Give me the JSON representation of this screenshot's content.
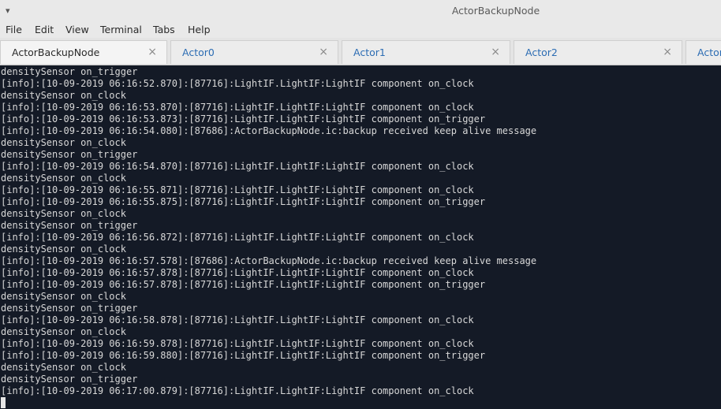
{
  "window": {
    "title": "ActorBackupNode",
    "menu_arrow": "▾"
  },
  "menubar": {
    "items": [
      "File",
      "Edit",
      "View",
      "Terminal",
      "Tabs",
      "Help"
    ]
  },
  "tabs": [
    {
      "label": "ActorBackupNode",
      "active": true
    },
    {
      "label": "Actor0",
      "active": false
    },
    {
      "label": "Actor1",
      "active": false
    },
    {
      "label": "Actor2",
      "active": false
    },
    {
      "label": "Actor",
      "active": false
    }
  ],
  "tab_close_glyph": "×",
  "terminal": {
    "lines": [
      "densitySensor on_trigger",
      "[info]:[10-09-2019 06:16:52.870]:[87716]:LightIF.LightIF:LightIF component on_clock",
      "densitySensor on_clock",
      "[info]:[10-09-2019 06:16:53.870]:[87716]:LightIF.LightIF:LightIF component on_clock",
      "[info]:[10-09-2019 06:16:53.873]:[87716]:LightIF.LightIF:LightIF component on_trigger",
      "[info]:[10-09-2019 06:16:54.080]:[87686]:ActorBackupNode.ic:backup received keep alive message",
      "densitySensor on_clock",
      "densitySensor on_trigger",
      "[info]:[10-09-2019 06:16:54.870]:[87716]:LightIF.LightIF:LightIF component on_clock",
      "densitySensor on_clock",
      "[info]:[10-09-2019 06:16:55.871]:[87716]:LightIF.LightIF:LightIF component on_clock",
      "[info]:[10-09-2019 06:16:55.875]:[87716]:LightIF.LightIF:LightIF component on_trigger",
      "densitySensor on_clock",
      "densitySensor on_trigger",
      "[info]:[10-09-2019 06:16:56.872]:[87716]:LightIF.LightIF:LightIF component on_clock",
      "densitySensor on_clock",
      "[info]:[10-09-2019 06:16:57.578]:[87686]:ActorBackupNode.ic:backup received keep alive message",
      "[info]:[10-09-2019 06:16:57.878]:[87716]:LightIF.LightIF:LightIF component on_clock",
      "[info]:[10-09-2019 06:16:57.878]:[87716]:LightIF.LightIF:LightIF component on_trigger",
      "densitySensor on_clock",
      "densitySensor on_trigger",
      "[info]:[10-09-2019 06:16:58.878]:[87716]:LightIF.LightIF:LightIF component on_clock",
      "densitySensor on_clock",
      "[info]:[10-09-2019 06:16:59.878]:[87716]:LightIF.LightIF:LightIF component on_clock",
      "[info]:[10-09-2019 06:16:59.880]:[87716]:LightIF.LightIF:LightIF component on_trigger",
      "densitySensor on_clock",
      "densitySensor on_trigger",
      "[info]:[10-09-2019 06:17:00.879]:[87716]:LightIF.LightIF:LightIF component on_clock"
    ]
  },
  "colors": {
    "terminal_bg": "#141a26",
    "terminal_fg": "#d8d8d8",
    "tab_label": "#2b6cb3"
  }
}
